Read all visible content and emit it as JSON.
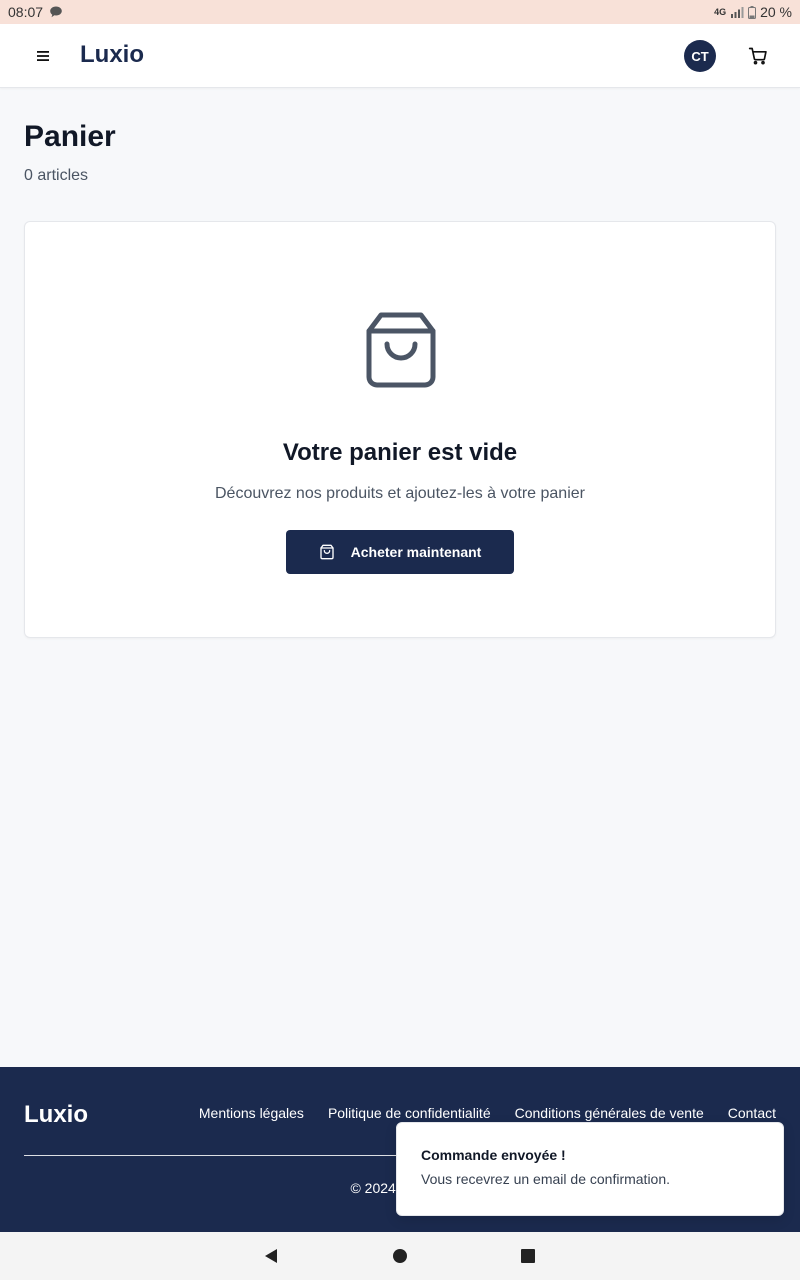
{
  "status_bar": {
    "time": "08:07",
    "network": "4G",
    "battery": "20 %"
  },
  "header": {
    "brand": "Luxio",
    "avatar_initials": "CT",
    "icons": [
      "menu-icon",
      "cart-icon"
    ]
  },
  "page": {
    "title": "Panier",
    "count": "0 articles"
  },
  "empty_cart": {
    "icon": "shopping-bag-icon",
    "title": "Votre panier est vide",
    "subtitle": "Découvrez nos produits et ajoutez-les à votre panier",
    "button_label": "Acheter maintenant"
  },
  "footer": {
    "brand": "Luxio",
    "links": [
      "Mentions légales",
      "Politique de confidentialité",
      "Conditions générales de vente",
      "Contact"
    ],
    "copyright": "© 2024 Luxio. A"
  },
  "toast": {
    "title": "Commande envoyée !",
    "message": "Vous recevrez un email de confirmation."
  },
  "colors": {
    "primary": "#1b2a4e",
    "status_bar": "#f8e1d8",
    "background": "#f7f8fa"
  }
}
